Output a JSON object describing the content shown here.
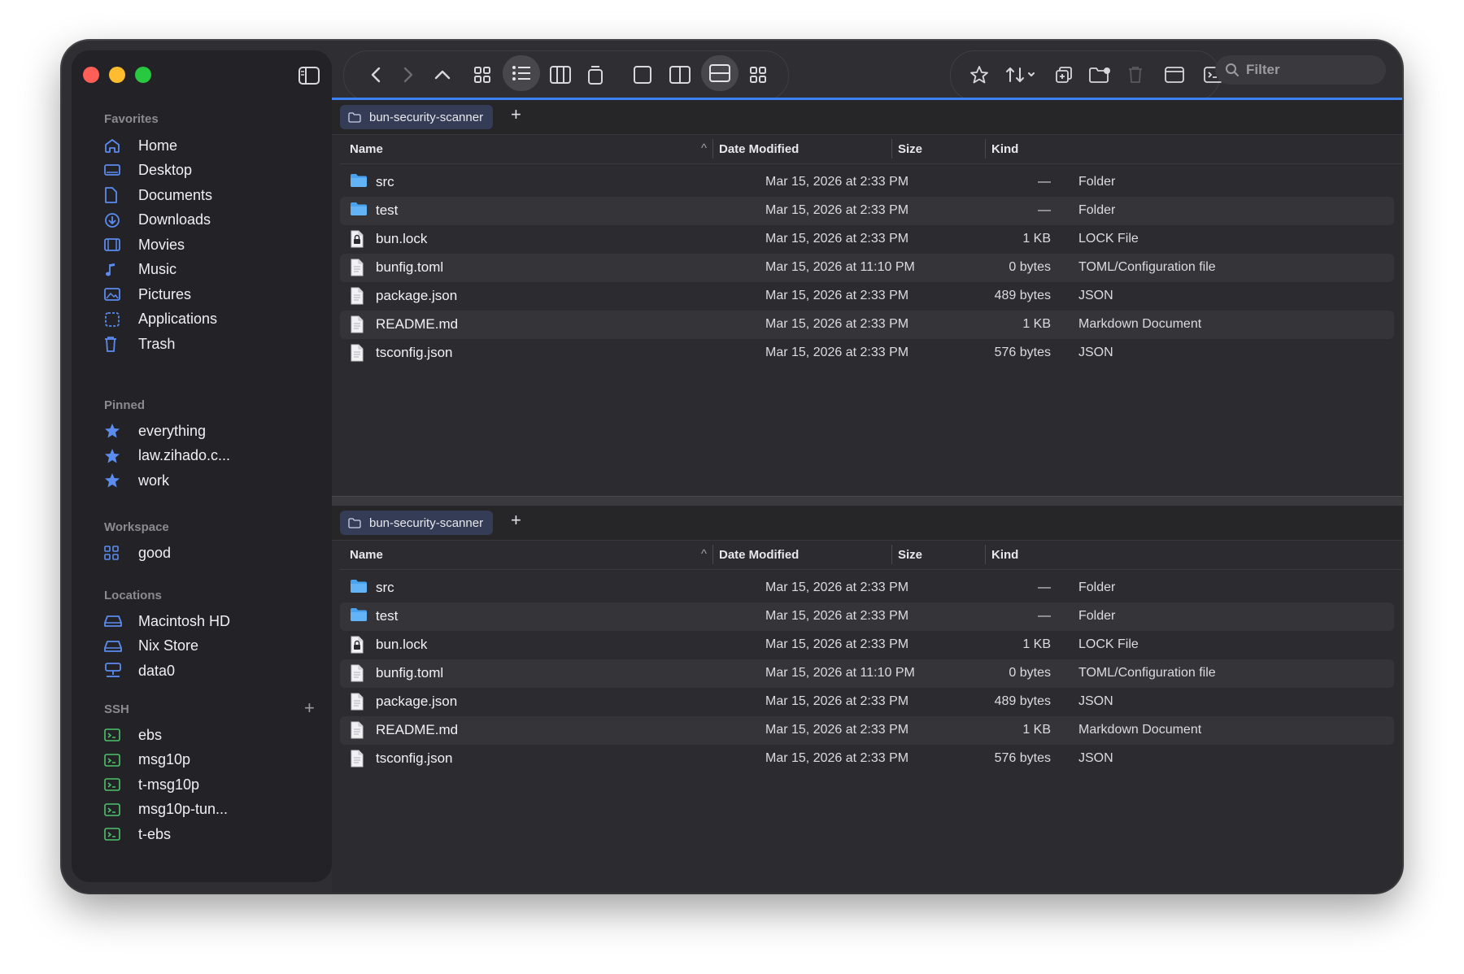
{
  "sidebar": {
    "favorites_title": "Favorites",
    "favorites": [
      {
        "label": "Home",
        "icon": "home-icon"
      },
      {
        "label": "Desktop",
        "icon": "desktop-icon"
      },
      {
        "label": "Documents",
        "icon": "document-icon"
      },
      {
        "label": "Downloads",
        "icon": "download-icon"
      },
      {
        "label": "Movies",
        "icon": "film-icon"
      },
      {
        "label": "Music",
        "icon": "music-note-icon"
      },
      {
        "label": "Pictures",
        "icon": "photo-icon"
      },
      {
        "label": "Applications",
        "icon": "applications-icon"
      },
      {
        "label": "Trash",
        "icon": "trash-icon"
      }
    ],
    "pinned_title": "Pinned",
    "pinned": [
      {
        "label": "everything",
        "icon": "star-icon"
      },
      {
        "label": "law.zihado.c...",
        "icon": "star-icon"
      },
      {
        "label": "work",
        "icon": "star-icon"
      }
    ],
    "workspace_title": "Workspace",
    "workspace": [
      {
        "label": "good",
        "icon": "grid-icon"
      }
    ],
    "locations_title": "Locations",
    "locations": [
      {
        "label": "Macintosh HD",
        "icon": "drive-icon"
      },
      {
        "label": "Nix Store",
        "icon": "drive-icon"
      },
      {
        "label": "data0",
        "icon": "network-drive-icon"
      }
    ],
    "ssh_title": "SSH",
    "ssh": [
      {
        "label": "ebs",
        "icon": "terminal-icon"
      },
      {
        "label": "msg10p",
        "icon": "terminal-icon"
      },
      {
        "label": "t-msg10p",
        "icon": "terminal-icon"
      },
      {
        "label": "msg10p-tun...",
        "icon": "terminal-icon"
      },
      {
        "label": "t-ebs",
        "icon": "terminal-icon"
      }
    ]
  },
  "toolbar": {
    "filter_placeholder": "Filter"
  },
  "colors": {
    "accent": "#3b82f6",
    "folder": "#4aa3f0",
    "terminal": "#4cc46a",
    "tab_bg": "#343d55"
  },
  "panes": [
    {
      "tab_label": "bun-security-scanner",
      "columns": {
        "name": "Name",
        "date": "Date Modified",
        "size": "Size",
        "kind": "Kind"
      },
      "files": [
        {
          "name": "src",
          "date": "Mar 15, 2026 at 2:33 PM",
          "size": "—",
          "kind": "Folder",
          "type": "folder"
        },
        {
          "name": "test",
          "date": "Mar 15, 2026 at 2:33 PM",
          "size": "—",
          "kind": "Folder",
          "type": "folder"
        },
        {
          "name": "bun.lock",
          "date": "Mar 15, 2026 at 2:33 PM",
          "size": "1 KB",
          "kind": "LOCK File",
          "type": "lock"
        },
        {
          "name": "bunfig.toml",
          "date": "Mar 15, 2026 at 11:10 PM",
          "size": "0 bytes",
          "kind": "TOML/Configuration file",
          "type": "file"
        },
        {
          "name": "package.json",
          "date": "Mar 15, 2026 at 2:33 PM",
          "size": "489 bytes",
          "kind": "JSON",
          "type": "file"
        },
        {
          "name": "README.md",
          "date": "Mar 15, 2026 at 2:33 PM",
          "size": "1 KB",
          "kind": "Markdown Document",
          "type": "file"
        },
        {
          "name": "tsconfig.json",
          "date": "Mar 15, 2026 at 2:33 PM",
          "size": "576 bytes",
          "kind": "JSON",
          "type": "file"
        }
      ]
    },
    {
      "tab_label": "bun-security-scanner",
      "columns": {
        "name": "Name",
        "date": "Date Modified",
        "size": "Size",
        "kind": "Kind"
      },
      "files": [
        {
          "name": "src",
          "date": "Mar 15, 2026 at 2:33 PM",
          "size": "—",
          "kind": "Folder",
          "type": "folder"
        },
        {
          "name": "test",
          "date": "Mar 15, 2026 at 2:33 PM",
          "size": "—",
          "kind": "Folder",
          "type": "folder"
        },
        {
          "name": "bun.lock",
          "date": "Mar 15, 2026 at 2:33 PM",
          "size": "1 KB",
          "kind": "LOCK File",
          "type": "lock"
        },
        {
          "name": "bunfig.toml",
          "date": "Mar 15, 2026 at 11:10 PM",
          "size": "0 bytes",
          "kind": "TOML/Configuration file",
          "type": "file"
        },
        {
          "name": "package.json",
          "date": "Mar 15, 2026 at 2:33 PM",
          "size": "489 bytes",
          "kind": "JSON",
          "type": "file"
        },
        {
          "name": "README.md",
          "date": "Mar 15, 2026 at 2:33 PM",
          "size": "1 KB",
          "kind": "Markdown Document",
          "type": "file"
        },
        {
          "name": "tsconfig.json",
          "date": "Mar 15, 2026 at 2:33 PM",
          "size": "576 bytes",
          "kind": "JSON",
          "type": "file"
        }
      ]
    }
  ]
}
